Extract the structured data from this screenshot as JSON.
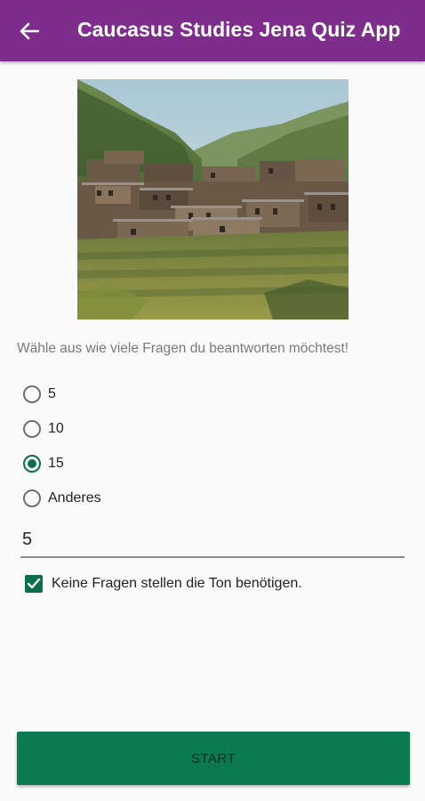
{
  "appbar": {
    "title": "Caucasus Studies Jena Quiz App",
    "back_icon": "arrow-left-icon",
    "color": "#7e2d8c"
  },
  "hero_image": {
    "description_icon": "village-photo"
  },
  "prompt": "Wähle aus wie viele Fragen du beantworten möchtest!",
  "options": [
    {
      "label": "5",
      "checked": false
    },
    {
      "label": "10",
      "checked": false
    },
    {
      "label": "15",
      "checked": true
    },
    {
      "label": "Anderes",
      "checked": false
    }
  ],
  "custom_input": {
    "value": "5"
  },
  "no_sound_checkbox": {
    "label": "Keine Fragen stellen die Ton benötigen.",
    "checked": true
  },
  "start_button": {
    "label": "START",
    "color": "#0b7a53"
  },
  "accent_color": "#0a6f4a"
}
